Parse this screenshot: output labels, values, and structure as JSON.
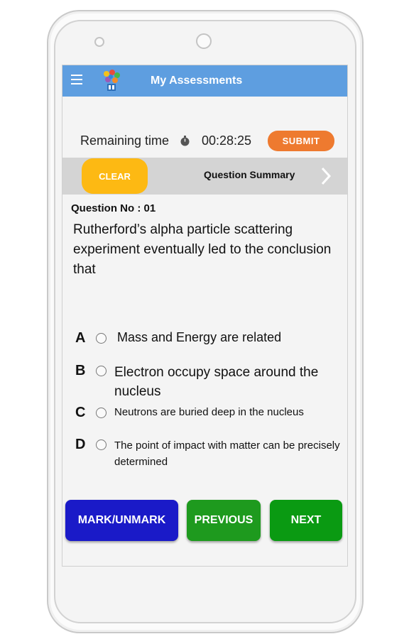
{
  "appbar": {
    "title": "My Assessments",
    "menu_icon": "hamburger-menu-icon",
    "logo_icon": "app-logo-icon"
  },
  "timer": {
    "label": "Remaining time",
    "icon": "stopwatch-icon",
    "value": "00:28:25"
  },
  "actions": {
    "submit_label": "SUBMIT",
    "clear_label": "CLEAR",
    "summary_label": "Question Summary"
  },
  "question": {
    "number_label": "Question No : 01",
    "text": "Rutherford’s alpha particle scattering experiment eventually led to the conclusion that",
    "options": [
      {
        "letter": "A",
        "text": "Mass and Energy are related"
      },
      {
        "letter": "B",
        "text": "Electron occupy space around the nucleus"
      },
      {
        "letter": "C",
        "text": "Neutrons are buried deep in the nucleus"
      },
      {
        "letter": "D",
        "text": "The point of impact with matter can be precisely determined"
      }
    ]
  },
  "nav": {
    "mark_label": "MARK/UNMARK",
    "previous_label": "PREVIOUS",
    "next_label": "NEXT"
  },
  "colors": {
    "appbar": "#5e9ee0",
    "submit": "#ee7a2f",
    "clear": "#fdb913",
    "mark": "#1a1ac8",
    "previous": "#1e9a1e",
    "next": "#0a9a12"
  }
}
